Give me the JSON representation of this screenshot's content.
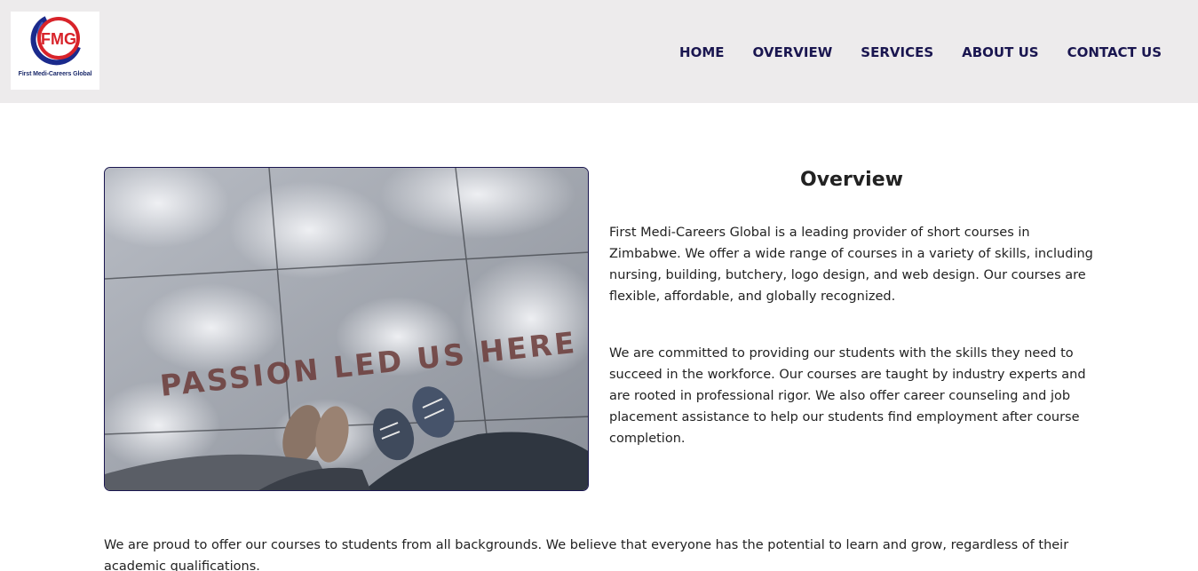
{
  "header": {
    "logo": {
      "monogram": "FMG",
      "name": "First Medi-Careers Global"
    },
    "nav": [
      {
        "label": "HOME"
      },
      {
        "label": "OVERVIEW"
      },
      {
        "label": "SERVICES"
      },
      {
        "label": "ABOUT US"
      },
      {
        "label": "CONTACT US"
      }
    ],
    "colors": {
      "background": "#edebec",
      "nav_text": "#1a1650",
      "logo_red": "#d8232a",
      "logo_blue": "#1b2a8c"
    }
  },
  "main": {
    "image": {
      "text_in_image": "PASSION LED US HERE"
    },
    "overview": {
      "title": "Overview",
      "paragraph_1": "First Medi-Careers Global is a leading provider of short courses in Zimbabwe. We offer a wide range of courses in a variety of skills, including nursing, building, butchery, logo design, and web design. Our courses are flexible, affordable, and globally recognized.",
      "paragraph_2": "We are committed to providing our students with the skills they need to succeed in the workforce. Our courses are taught by industry experts and are rooted in professional rigor. We also offer career counseling and job placement assistance to help our students find employment after course completion."
    },
    "paragraph_3": "We are proud to offer our courses to students from all backgrounds. We believe that everyone has the potential to learn and grow, regardless of their academic qualifications."
  }
}
